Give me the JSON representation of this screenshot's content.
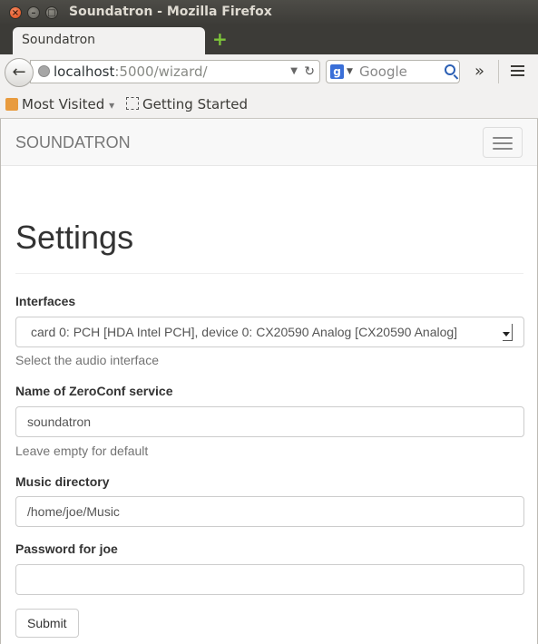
{
  "window": {
    "title": "Soundatron - Mozilla Firefox",
    "close_glyph": "×",
    "minimize_glyph": "–",
    "maximize_glyph": "□"
  },
  "tabs": [
    {
      "label": "Soundatron"
    }
  ],
  "new_tab_glyph": "+",
  "navbar": {
    "back_glyph": "←",
    "url_host": "localhost",
    "url_rest": ":5000/wizard/",
    "dropdown_glyph": "▼",
    "reload_glyph": "↻",
    "search_engine_glyph": "g",
    "search_placeholder": "Google",
    "overflow_glyph": "»"
  },
  "bookmarks": {
    "most_visited": "Most Visited",
    "most_visited_arrow": "▾",
    "getting_started": "Getting Started"
  },
  "page": {
    "brand": "SOUNDATRON",
    "heading": "Settings",
    "interfaces": {
      "label": "Interfaces",
      "selected": "card 0: PCH [HDA Intel PCH], device 0: CX20590 Analog [CX20590 Analog]",
      "help": "Select the audio interface"
    },
    "zeroconf": {
      "label": "Name of ZeroConf service",
      "value": "soundatron",
      "help": "Leave empty for default"
    },
    "music_dir": {
      "label": "Music directory",
      "value": "/home/joe/Music"
    },
    "password": {
      "label": "Password for joe",
      "value": ""
    },
    "submit_label": "Submit"
  },
  "icons": {
    "back": "back-arrow-icon",
    "globe": "globe-icon",
    "reload": "reload-icon",
    "search": "search-icon",
    "menu": "hamburger-menu-icon",
    "new_tab": "plus-icon"
  }
}
